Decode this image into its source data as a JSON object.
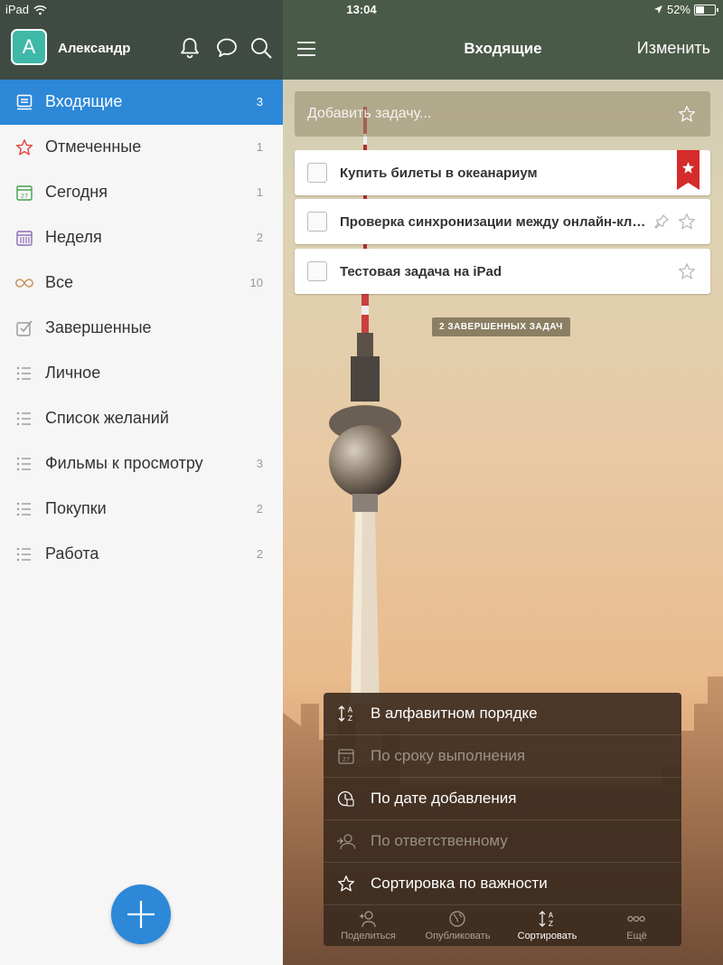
{
  "status_bar": {
    "device": "iPad",
    "time": "13:04",
    "battery": "52%",
    "battery_level": 0.52
  },
  "sidebar": {
    "avatar_letter": "A",
    "username": "Александр",
    "lists": [
      {
        "label": "Входящие",
        "count": "3",
        "icon": "inbox-icon",
        "active": true
      },
      {
        "label": "Отмеченные",
        "count": "1",
        "icon": "star-icon"
      },
      {
        "label": "Сегодня",
        "count": "1",
        "icon": "calendar-today-icon"
      },
      {
        "label": "Неделя",
        "count": "2",
        "icon": "calendar-week-icon"
      },
      {
        "label": "Все",
        "count": "10",
        "icon": "infinity-icon"
      },
      {
        "label": "Завершенные",
        "count": "",
        "icon": "checkbox-icon"
      },
      {
        "label": "Личное",
        "count": "",
        "icon": "list-icon"
      },
      {
        "label": "Список желаний",
        "count": "",
        "icon": "list-icon"
      },
      {
        "label": "Фильмы к просмотру",
        "count": "3",
        "icon": "list-icon"
      },
      {
        "label": "Покупки",
        "count": "2",
        "icon": "list-icon"
      },
      {
        "label": "Работа",
        "count": "2",
        "icon": "list-icon"
      }
    ]
  },
  "main": {
    "title": "Входящие",
    "edit_label": "Изменить",
    "add_task_placeholder": "Добавить задачу...",
    "tasks": [
      {
        "title": "Купить билеты в океанариум",
        "starred": true
      },
      {
        "title": "Проверка синхронизации между онлайн-клиентом",
        "starred": false,
        "pinned": true
      },
      {
        "title": "Тестовая задача на iPad",
        "starred": false
      }
    ],
    "completed_label": "2 ЗАВЕРШЕННЫХ ЗАДАЧ"
  },
  "sort_menu": {
    "options": [
      {
        "label": "В алфавитном порядке",
        "icon": "sort-alpha-icon",
        "enabled": true
      },
      {
        "label": "По сроку выполнения",
        "icon": "calendar-icon",
        "enabled": false
      },
      {
        "label": "По дате добавления",
        "icon": "clock-icon",
        "enabled": true
      },
      {
        "label": "По ответственному",
        "icon": "assign-user-icon",
        "enabled": false
      },
      {
        "label": "Сортировка по важности",
        "icon": "star-outline-icon",
        "enabled": true
      }
    ],
    "toolbar": [
      {
        "label": "Поделиться",
        "icon": "share-user-icon"
      },
      {
        "label": "Опубликовать",
        "icon": "globe-icon"
      },
      {
        "label": "Сортировать",
        "icon": "sort-icon",
        "active": true
      },
      {
        "label": "Ещё",
        "icon": "more-icon"
      }
    ]
  },
  "colors": {
    "accent": "#2d88d8",
    "header": "#3f4a42",
    "ribbon": "#d52b2b"
  }
}
